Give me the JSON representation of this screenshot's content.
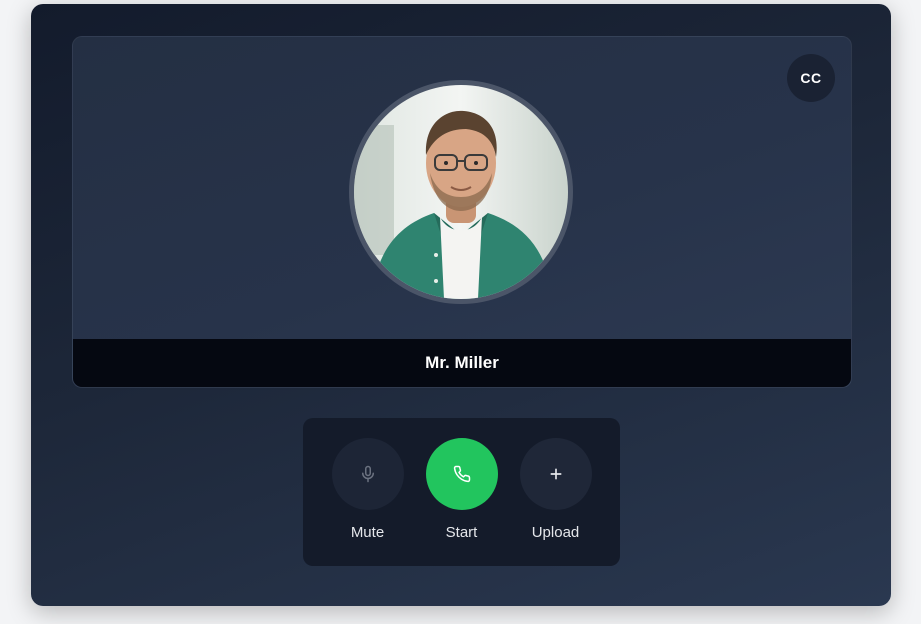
{
  "caption_button": {
    "label": "CC"
  },
  "caller": {
    "name": "Mr. Miller"
  },
  "controls": [
    {
      "label": "Mute",
      "icon": "microphone-icon"
    },
    {
      "label": "Start",
      "icon": "phone-icon"
    },
    {
      "label": "Upload",
      "icon": "plus-icon"
    }
  ],
  "colors": {
    "start_green": "#22c55e",
    "card_bg": "#1d2739",
    "name_bar": "#050811"
  }
}
